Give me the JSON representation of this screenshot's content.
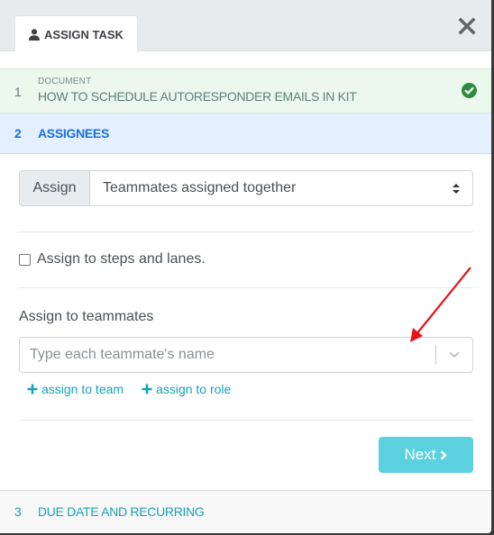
{
  "header": {
    "tab_label": "ASSIGN TASK",
    "tab_icon": "user-icon",
    "close_icon": "close-icon"
  },
  "steps": [
    {
      "number": "1",
      "subtitle": "DOCUMENT",
      "title": "HOW TO SCHEDULE AUTORESPONDER EMAILS IN KIT",
      "status": "complete"
    },
    {
      "number": "2",
      "title": "ASSIGNEES",
      "status": "active"
    },
    {
      "number": "3",
      "title": "DUE DATE AND RECURRING",
      "status": "pending"
    }
  ],
  "form": {
    "assign_addon": "Assign",
    "assign_mode_selected": "Teammates assigned together",
    "steps_lanes_checkbox_label": "Assign to steps and lanes.",
    "steps_lanes_checked": false,
    "teammates_label": "Assign to teammates",
    "teammates_placeholder": "Type each teammate's name",
    "teammates_value": "",
    "assign_to_team_link": "assign to team",
    "assign_to_role_link": "assign to role",
    "next_button": "Next"
  },
  "colors": {
    "complete_bg": "#ecf7ee",
    "active_bg": "#e4efff",
    "active_text": "#1a6fd9",
    "link": "#17a2b8",
    "next_button_bg": "#5bd0df",
    "check_green": "#2e8b3e",
    "annotation_arrow": "#e8141b"
  }
}
